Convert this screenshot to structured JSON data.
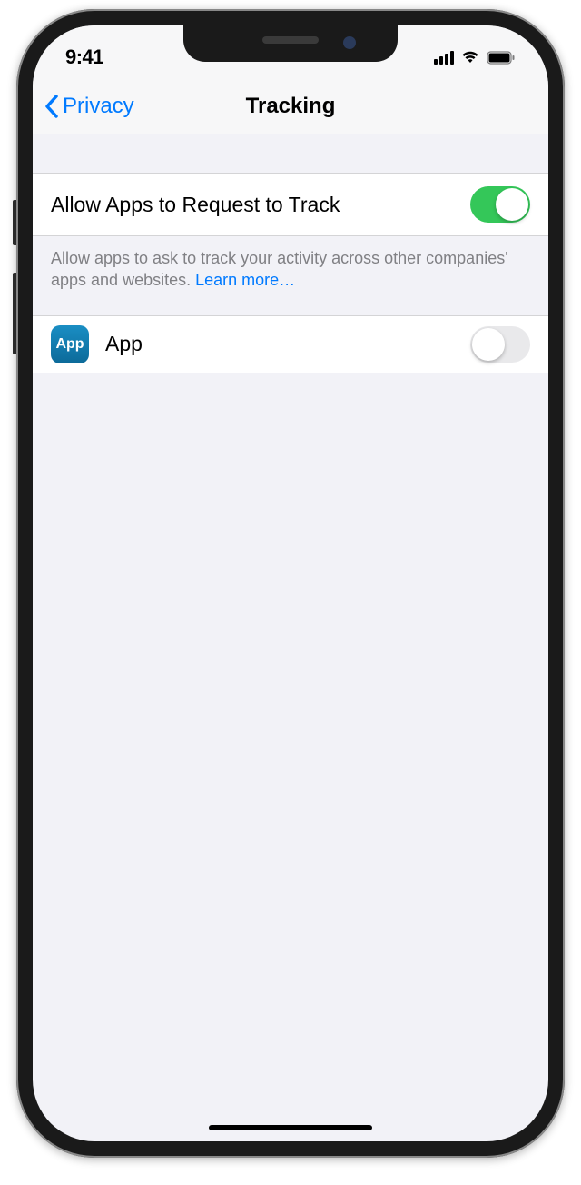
{
  "statusBar": {
    "time": "9:41"
  },
  "nav": {
    "backLabel": "Privacy",
    "title": "Tracking"
  },
  "settings": {
    "allowTrack": {
      "label": "Allow Apps to Request to Track",
      "enabled": true,
      "footer": "Allow apps to ask to track your activity across other companies' apps and websites. ",
      "learnMore": "Learn more…"
    }
  },
  "apps": [
    {
      "iconText": "App",
      "name": "App",
      "enabled": false
    }
  ]
}
